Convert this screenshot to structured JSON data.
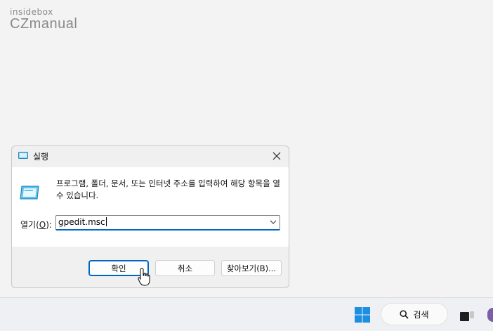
{
  "watermark": {
    "line1": "insidebox",
    "line2": "CZmanual"
  },
  "dialog": {
    "title": "실행",
    "description": "프로그램, 폴더, 문서, 또는 인터넷 주소를 입력하여 해당 항목을 열 수 있습니다.",
    "open_label_prefix": "열기(",
    "open_label_key": "O",
    "open_label_suffix": "):",
    "input_value": "gpedit.msc",
    "ok_label": "확인",
    "cancel_label": "취소",
    "browse_label": "찾아보기(B)...",
    "accent_color": "#0067c0"
  },
  "taskbar": {
    "search_label": "검색",
    "icons": [
      "windows-start-icon",
      "search-icon",
      "task-view-icon",
      "copilot-icon"
    ]
  }
}
